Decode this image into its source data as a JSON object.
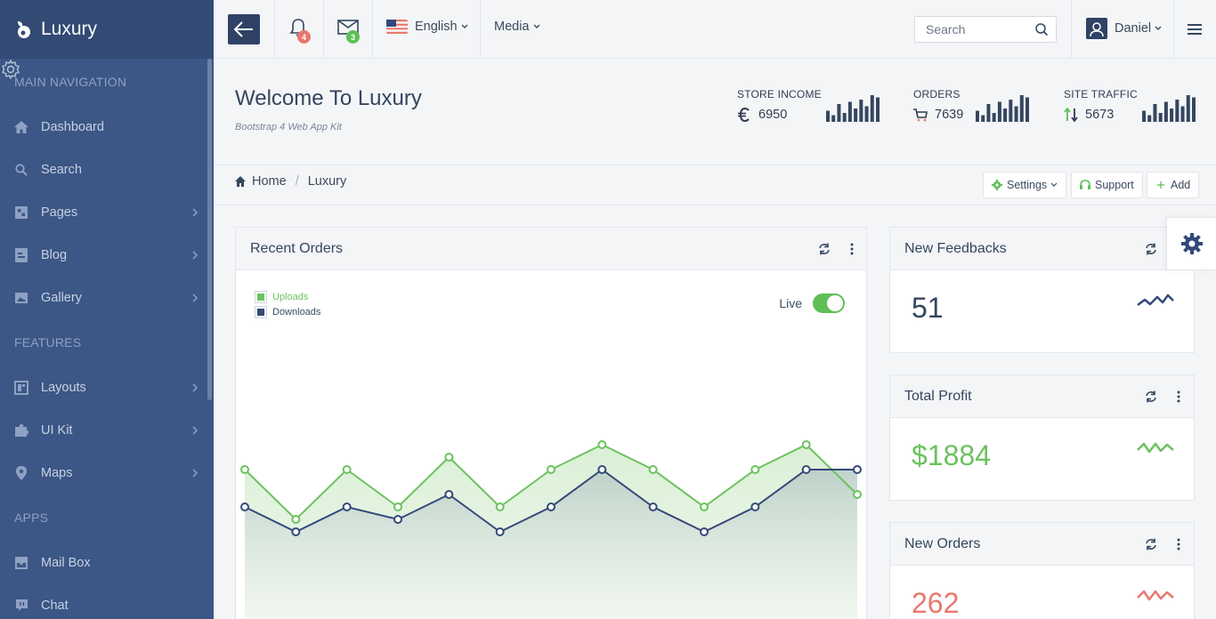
{
  "brand": {
    "name": "Luxury"
  },
  "sidebar": {
    "sections": [
      "MAIN NAVIGATION",
      "FEATURES",
      "APPS"
    ],
    "items": [
      {
        "label": "Dashboard",
        "icon": "home-icon",
        "has_children": false
      },
      {
        "label": "Search",
        "icon": "search-icon",
        "has_children": false
      },
      {
        "label": "Pages",
        "icon": "pages-icon",
        "has_children": true
      },
      {
        "label": "Blog",
        "icon": "blog-icon",
        "has_children": true
      },
      {
        "label": "Gallery",
        "icon": "image-icon",
        "has_children": true
      },
      {
        "label": "Layouts",
        "icon": "layout-icon",
        "has_children": true
      },
      {
        "label": "UI Kit",
        "icon": "puzzle-icon",
        "has_children": true
      },
      {
        "label": "Maps",
        "icon": "map-pin-icon",
        "has_children": true
      },
      {
        "label": "Mail Box",
        "icon": "inbox-icon",
        "has_children": false
      },
      {
        "label": "Chat",
        "icon": "chat-icon",
        "has_children": false
      }
    ]
  },
  "topbar": {
    "notifications_count": "4",
    "messages_count": "3",
    "language": "English",
    "media": "Media",
    "search_placeholder": "Search",
    "user_name": "Daniel"
  },
  "header": {
    "title": "Welcome To Luxury",
    "subtitle": "Bootstrap 4 Web App Kit",
    "stats": [
      {
        "label": "STORE INCOME",
        "value": "6950",
        "icon": "euro-icon",
        "bars": [
          5,
          3,
          8,
          4,
          9,
          6,
          10,
          7,
          12,
          11
        ]
      },
      {
        "label": "ORDERS",
        "value": "7639",
        "icon": "cart-icon",
        "bars": [
          5,
          3,
          8,
          4,
          9,
          6,
          10,
          7,
          12,
          11
        ]
      },
      {
        "label": "SITE TRAFFIC",
        "value": "5673",
        "icon": "arrows-updown-icon",
        "bars": [
          5,
          3,
          8,
          4,
          9,
          6,
          10,
          7,
          12,
          11
        ]
      }
    ]
  },
  "breadcrumb": {
    "home": "Home",
    "current": "Luxury"
  },
  "actions": {
    "settings": "Settings",
    "support": "Support",
    "add": "Add"
  },
  "recent_orders": {
    "title": "Recent Orders",
    "live_label": "Live",
    "live_on": true
  },
  "chart_data": {
    "type": "area",
    "series": [
      {
        "name": "Uploads",
        "color": "#6cc25f",
        "values": [
          60,
          40,
          60,
          45,
          65,
          45,
          60,
          70,
          60,
          45,
          60,
          70,
          50
        ]
      },
      {
        "name": "Downloads",
        "color": "#34497a",
        "values": [
          45,
          35,
          45,
          40,
          50,
          35,
          45,
          60,
          45,
          35,
          45,
          60,
          60
        ]
      }
    ],
    "ylim": [
      0,
      100
    ]
  },
  "cards": [
    {
      "title": "New Feedbacks",
      "value": "51",
      "color": "#34465f",
      "trend_color": "#34497a"
    },
    {
      "title": "Total Profit",
      "value": "$1884",
      "color": "#6cc25f",
      "trend_color": "#6cc25f"
    },
    {
      "title": "New Orders",
      "value": "262",
      "color": "#e8786e",
      "trend_color": "#e8786e"
    }
  ]
}
